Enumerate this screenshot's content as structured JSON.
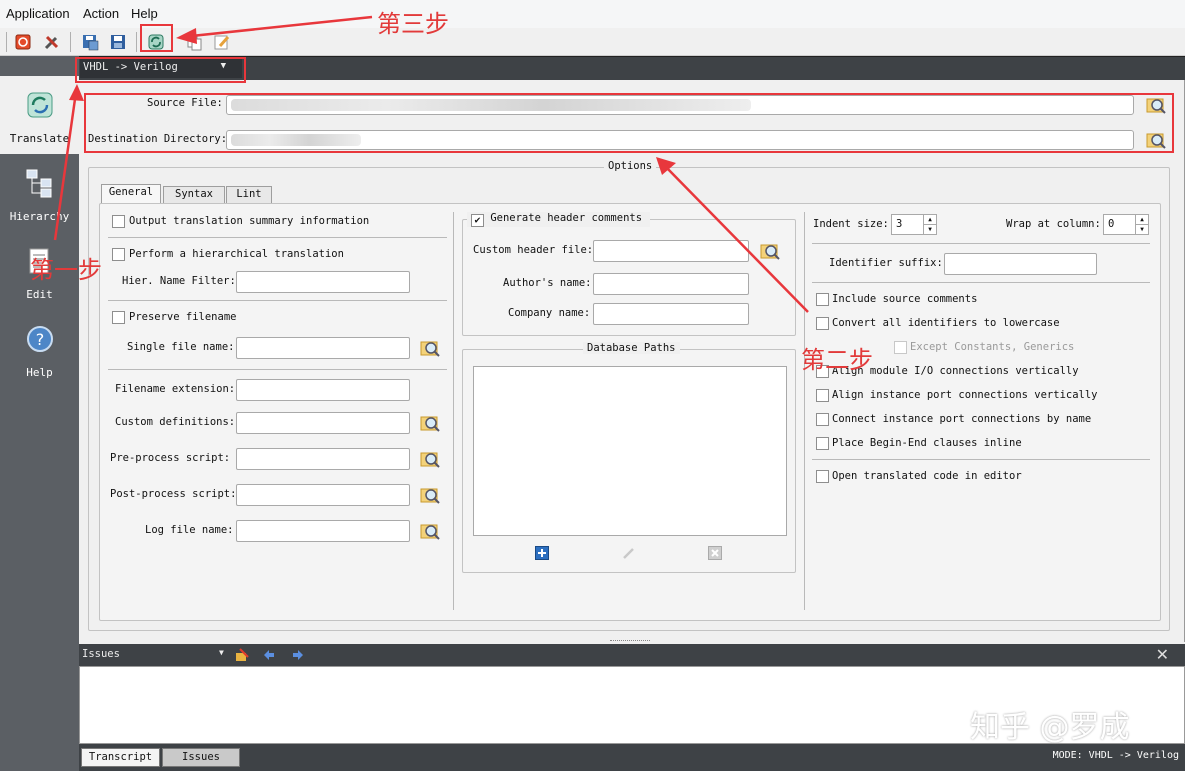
{
  "menu": [
    "Application",
    "Action",
    "Help"
  ],
  "sidebar": {
    "items": [
      {
        "label": "Translate",
        "icon": "translate-icon"
      },
      {
        "label": "Hierarchy",
        "icon": "hierarchy-icon"
      },
      {
        "label": "Edit",
        "icon": "edit-icon"
      },
      {
        "label": "Help",
        "icon": "help-icon"
      }
    ]
  },
  "mode_select": {
    "value": "VHDL -> Verilog"
  },
  "files": {
    "source_label": "Source File:",
    "dest_label": "Destination Directory:"
  },
  "options": {
    "title": "Options",
    "tabs": [
      "General",
      "Syntax",
      "Lint"
    ],
    "left": {
      "output_summary": "Output translation summary information",
      "hierarchical": "Perform a hierarchical translation",
      "hier_filter": "Hier. Name Filter:",
      "preserve_filename": "Preserve filename",
      "single_file": "Single file name:",
      "filename_ext": "Filename extension:",
      "custom_defs": "Custom definitions:",
      "preprocess": "Pre-process script:",
      "postprocess": "Post-process script:",
      "logfile": "Log file name:"
    },
    "middle": {
      "gen_header": "Generate header comments",
      "custom_header": "Custom header file:",
      "author": "Author's name:",
      "company": "Company name:",
      "db_paths": "Database Paths"
    },
    "right": {
      "indent_label": "Indent size:",
      "indent_value": "3",
      "wrap_label": "Wrap at column:",
      "wrap_value": "0",
      "ident_suffix": "Identifier suffix:",
      "include_source": "Include source comments",
      "convert_lower": "Convert all identifiers to lowercase",
      "except_constants": "Except Constants, Generics",
      "align_io": "Align module I/O connections vertically",
      "align_instance": "Align instance port connections vertically",
      "connect_by_name": "Connect instance port connections by name",
      "begin_end": "Place Begin-End clauses inline",
      "open_editor": "Open translated code in editor"
    }
  },
  "issues": {
    "title": "Issues"
  },
  "bottom_tabs": [
    "Transcript",
    "Issues"
  ],
  "status": "MODE: VHDL -> Verilog",
  "annotations": {
    "step1": "第一步",
    "step2": "第二步",
    "step3": "第三步"
  },
  "watermark": "知乎 @罗成",
  "colors": {
    "annotation": "#e8373c",
    "sidebar": "#5b5f64",
    "dark_bar": "#3e4246"
  }
}
